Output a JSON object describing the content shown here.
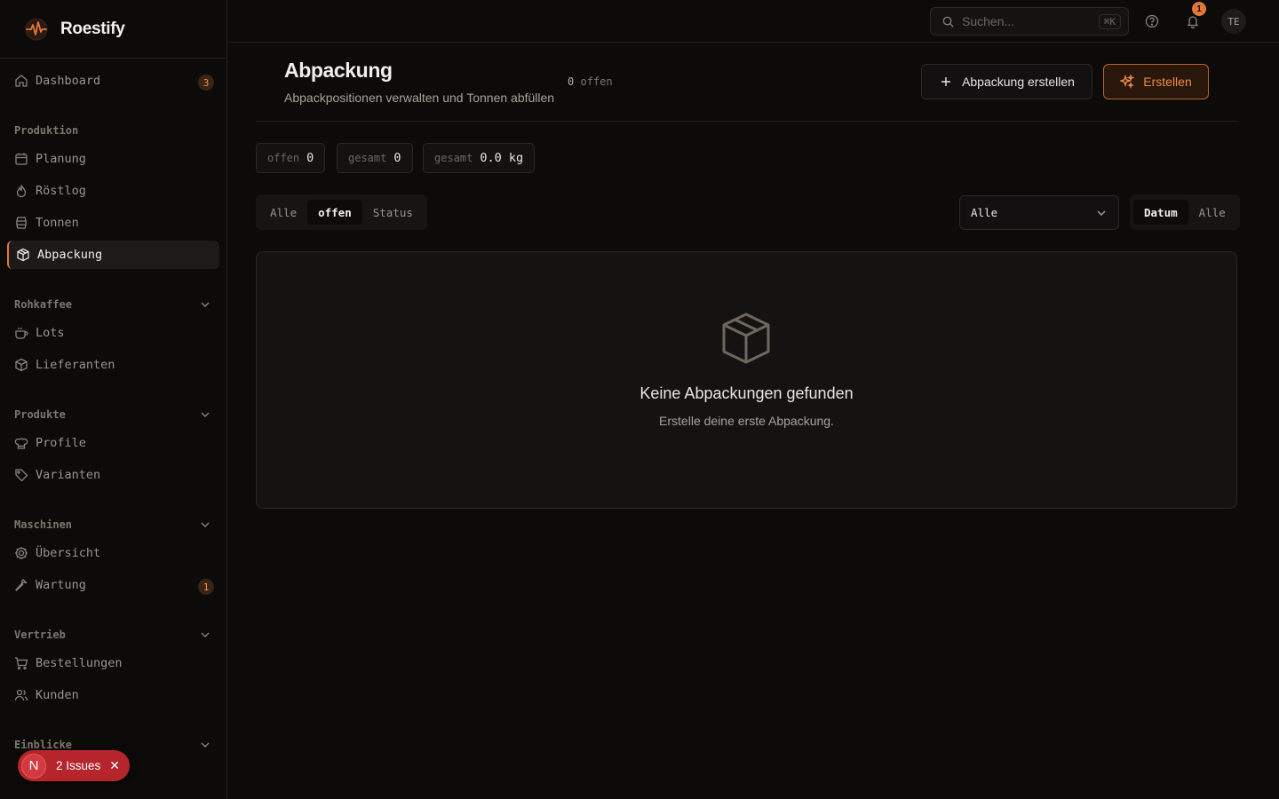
{
  "app": {
    "name": "Roestify"
  },
  "sidebar": {
    "dashboard": {
      "label": "Dashboard",
      "badge": "3"
    },
    "groups": {
      "produktion": "Produktion",
      "rohkaffee": "Rohkaffee",
      "produkte": "Produkte",
      "maschinen": "Maschinen",
      "vertrieb": "Vertrieb",
      "einblicke": "Einblicke"
    },
    "items": {
      "planung": "Planung",
      "roestlog": "Röstlog",
      "tonnen": "Tonnen",
      "abpackung": "Abpackung",
      "lots": "Lots",
      "lieferanten": "Lieferanten",
      "profile": "Profile",
      "varianten": "Varianten",
      "uebersicht": "Übersicht",
      "wartung": "Wartung",
      "bestellungen": "Bestellungen",
      "kunden": "Kunden"
    },
    "wartung_badge": "1"
  },
  "issues": {
    "letter": "N",
    "label": "2 Issues"
  },
  "topbar": {
    "search_placeholder": "Suchen...",
    "shortcut": "⌘K",
    "notification_count": "1",
    "avatar_initials": "TE"
  },
  "page": {
    "title": "Abpackung",
    "subtitle": "Abpackpositionen verwalten und Tonnen abfüllen",
    "open_count_value": "0",
    "open_count_label": "offen",
    "create_packaging_label": "Abpackung erstellen",
    "create_label": "Erstellen"
  },
  "stats": [
    {
      "label": "offen",
      "value": "0"
    },
    {
      "label": "gesamt",
      "value": "0"
    },
    {
      "label": "gesamt",
      "value": "0.0 kg"
    }
  ],
  "filter_tabs": [
    "Alle",
    "offen",
    "Status"
  ],
  "filter_active": "offen",
  "select_value": "Alle",
  "sort_tabs": [
    "Datum",
    "Alle"
  ],
  "sort_active": "Datum",
  "empty": {
    "title": "Keine Abpackungen gefunden",
    "subtitle": "Erstelle deine erste Abpackung."
  },
  "colors": {
    "accent": "#e0783a",
    "background": "#0c0b0a",
    "card": "#151311",
    "danger": "#b6252c"
  }
}
